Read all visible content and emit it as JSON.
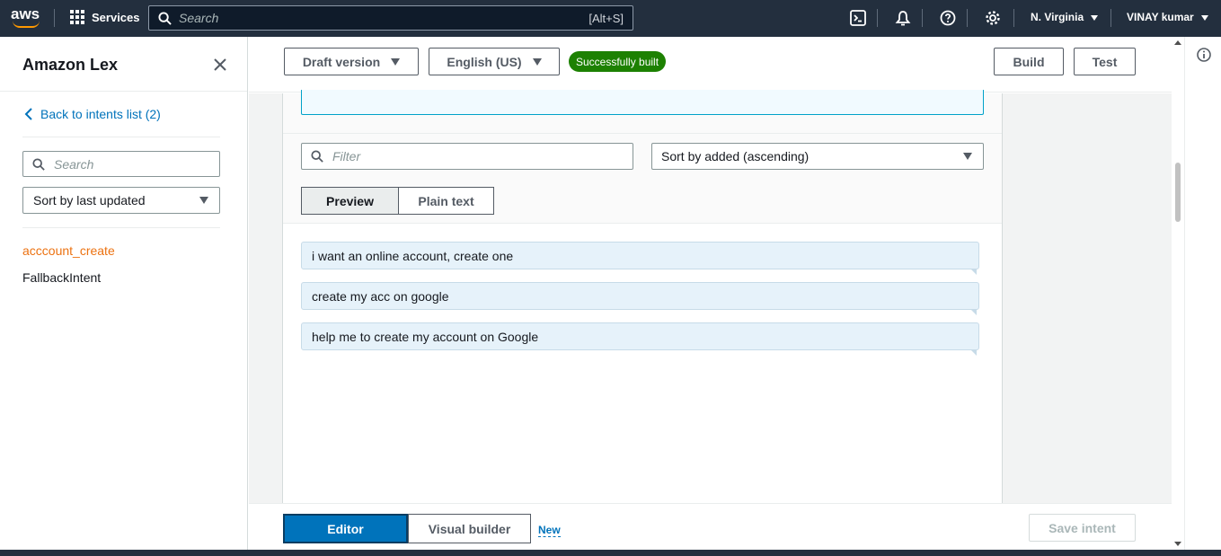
{
  "topnav": {
    "logo_text": "aws",
    "services_label": "Services",
    "search_placeholder": "Search",
    "search_shortcut": "[Alt+S]",
    "region": "N. Virginia",
    "user": "VINAY kumar",
    "icons": [
      "cloudshell-icon",
      "notifications-icon",
      "help-icon",
      "settings-icon"
    ]
  },
  "sidebar": {
    "title": "Amazon Lex",
    "back_link": "Back to intents list (2)",
    "search_placeholder": "Search",
    "sort_value": "Sort by last updated",
    "intents": [
      {
        "label": "acccount_create",
        "active": true
      },
      {
        "label": "FallbackIntent",
        "active": false
      }
    ]
  },
  "header": {
    "version_label": "Draft version",
    "language_label": "English (US)",
    "build_status": "Successfully built",
    "build_button": "Build",
    "test_button": "Test"
  },
  "utterances": {
    "filter_placeholder": "Filter",
    "sort_value": "Sort by added (ascending)",
    "view_tabs": [
      "Preview",
      "Plain text"
    ],
    "active_view": "Preview",
    "items": [
      "i want an online account, create one",
      "create my acc on google",
      "help me to create my account on Google"
    ]
  },
  "footer": {
    "editor_tab": "Editor",
    "visual_tab": "Visual builder",
    "new_badge": "New",
    "save_button": "Save intent"
  },
  "colors": {
    "nav_bg": "#232f3e",
    "accent_blue": "#0073bb",
    "active_intent": "#ec7211",
    "success_badge": "#1d8102",
    "utterance_bg": "#e6f2fa"
  }
}
